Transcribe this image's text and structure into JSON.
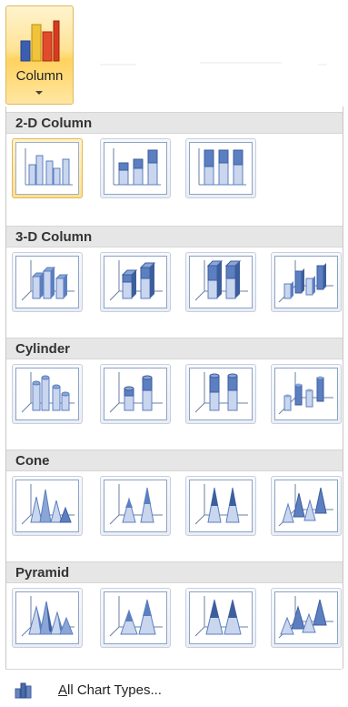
{
  "ribbon": {
    "button_label": "Column",
    "colors": {
      "accent_bg": "#ffe394",
      "accent_border": "#e0b95a"
    }
  },
  "sections": [
    {
      "title": "2-D Column",
      "items": [
        "clustered-column",
        "stacked-column",
        "100-stacked-column"
      ]
    },
    {
      "title": "3-D Column",
      "items": [
        "3d-clustered-column",
        "3d-stacked-column",
        "3d-100-stacked-column",
        "3d-column"
      ]
    },
    {
      "title": "Cylinder",
      "items": [
        "clustered-cylinder",
        "stacked-cylinder",
        "100-stacked-cylinder",
        "3d-cylinder"
      ]
    },
    {
      "title": "Cone",
      "items": [
        "clustered-cone",
        "stacked-cone",
        "100-stacked-cone",
        "3d-cone"
      ]
    },
    {
      "title": "Pyramid",
      "items": [
        "clustered-pyramid",
        "stacked-pyramid",
        "100-stacked-pyramid",
        "3d-pyramid"
      ]
    }
  ],
  "selected_item": "clustered-column",
  "footer": {
    "link_underlined_letter": "A",
    "link_rest": "ll Chart Types..."
  },
  "colors": {
    "section_bg": "#e6e6e6",
    "bar_fill": "#5b7fc0",
    "bar_light": "#c9d6ee"
  }
}
